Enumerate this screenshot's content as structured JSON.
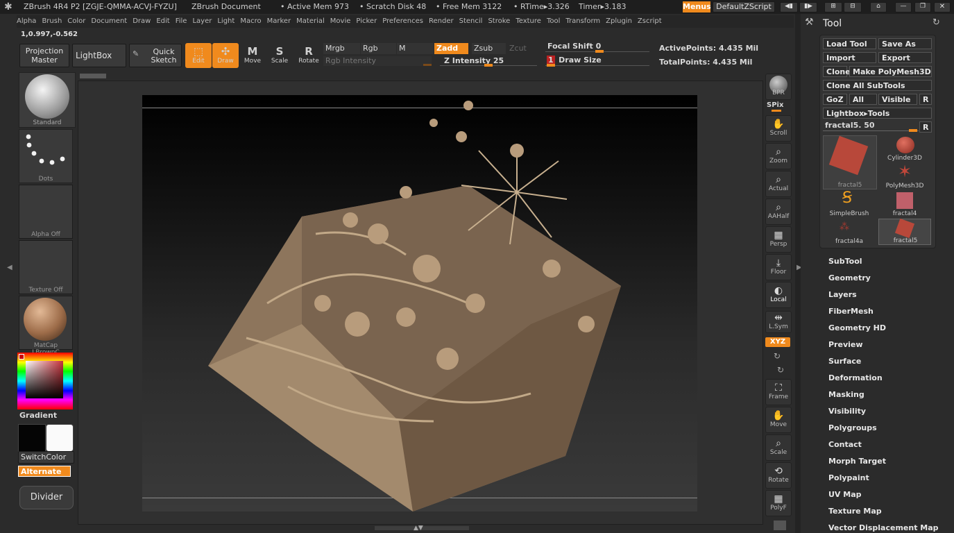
{
  "title_bar": {
    "app": "ZBrush 4R4 P2 [ZGJE-QMMA-ACVJ-FYZU]",
    "document": "ZBrush Document",
    "active_mem": "• Active Mem 973",
    "scratch_disk": "• Scratch Disk 48",
    "free_mem": "• Free Mem 3122",
    "rtime": "• RTime▸3.326",
    "timer": "Timer▸3.183",
    "menus_btn": "Menus",
    "script_btn": "DefaultZScript"
  },
  "menu_items": [
    "Alpha",
    "Brush",
    "Color",
    "Document",
    "Draw",
    "Edit",
    "File",
    "Layer",
    "Light",
    "Macro",
    "Marker",
    "Material",
    "Movie",
    "Picker",
    "Preferences",
    "Render",
    "Stencil",
    "Stroke",
    "Texture",
    "Tool",
    "Transform",
    "Zplugin",
    "Zscript"
  ],
  "coords": "1,0.997,-0.562",
  "toolbar": {
    "projection_master": "Projection Master",
    "lightbox": "LightBox",
    "quick_sketch": "Quick Sketch",
    "edit": "Edit",
    "draw": "Draw",
    "move": "Move",
    "scale": "Scale",
    "rotate": "Rotate",
    "mrgb": "Mrgb",
    "rgb": "Rgb",
    "m": "M",
    "zadd": "Zadd",
    "zsub": "Zsub",
    "zcut": "Zcut",
    "rgb_intensity": "Rgb Intensity",
    "z_intensity": "Z Intensity 25",
    "focal_shift": "Focal Shift 0",
    "draw_size_prefix": "1",
    "draw_size": "Draw Size",
    "active_points": "ActivePoints: 4.435 Mil",
    "total_points": "TotalPoints: 4.435 Mil"
  },
  "left_shelf": {
    "standard": "Standard",
    "dots": "Dots",
    "alpha_off": "Alpha Off",
    "texture_off": "Texture Off",
    "matcap": "MatCap LBrownC",
    "gradient": "Gradient",
    "switch_color": "SwitchColor",
    "alternate": "Alternate",
    "divider": "Divider"
  },
  "right_shelf": {
    "bpr": "BPR",
    "spix": "SPix",
    "scroll": "Scroll",
    "zoom": "Zoom",
    "actual": "Actual",
    "aahalf": "AAHalf",
    "persp": "Persp",
    "floor": "Floor",
    "local": "Local",
    "lsym": "L.Sym",
    "xyz": "XYZ",
    "frame": "Frame",
    "move": "Move",
    "scale": "Scale",
    "rotate": "Rotate",
    "polyf": "PolyF"
  },
  "tool_panel": {
    "title": "Tool",
    "load_tool": "Load Tool",
    "save_as": "Save As",
    "import": "Import",
    "export": "Export",
    "clone": "Clone",
    "make_polymesh": "Make PolyMesh3D",
    "clone_all": "Clone All SubTools",
    "goz": "GoZ",
    "all": "All",
    "visible": "Visible",
    "r": "R",
    "lightbox_tools": "Lightbox▸Tools",
    "current_tool": "fractal5. 50",
    "thumbs": [
      "fractal5",
      "Cylinder3D",
      "PolyMesh3D",
      "SimpleBrush",
      "fractal4",
      "fractal4a",
      "fractal5"
    ],
    "sections": [
      "SubTool",
      "Geometry",
      "Layers",
      "FiberMesh",
      "Geometry HD",
      "Preview",
      "Surface",
      "Deformation",
      "Masking",
      "Visibility",
      "Polygroups",
      "Contact",
      "Morph Target",
      "Polypaint",
      "UV Map",
      "Texture Map",
      "Vector Displacement Map"
    ]
  },
  "colors": {
    "accent": "#f08a1d",
    "sculpt": "#a0866a"
  }
}
